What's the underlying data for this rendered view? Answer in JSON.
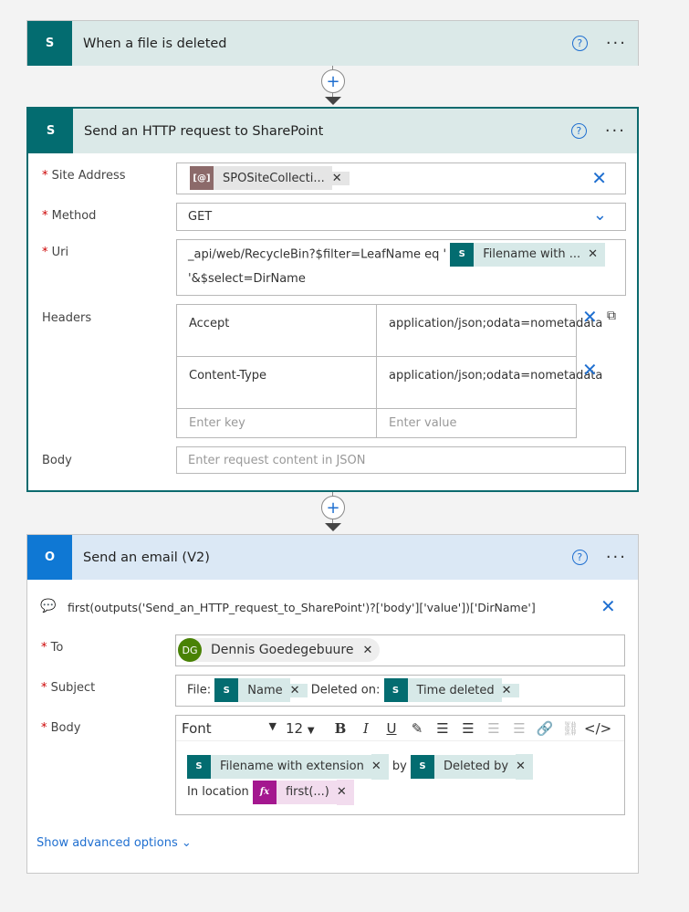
{
  "trigger": {
    "title": "When a file is deleted",
    "icon": "sharepoint-icon"
  },
  "http": {
    "title": "Send an HTTP request to SharePoint",
    "icon": "sharepoint-icon",
    "site_label": "Site Address",
    "site_token": "SPOSiteCollecti...",
    "site_token_icon": "[@]",
    "method_label": "Method",
    "method_value": "GET",
    "uri_label": "Uri",
    "uri_text1": "_api/web/RecycleBin?$filter=LeafName eq '",
    "uri_token": "Filename with ...",
    "uri_text2": "'&$select=DirName",
    "headers_label": "Headers",
    "headers": [
      {
        "key": "Accept",
        "value": "application/json;odata=nometadata"
      },
      {
        "key": "Content-Type",
        "value": "application/json;odata=nometadata"
      }
    ],
    "key_placeholder": "Enter key",
    "value_placeholder": "Enter value",
    "body_label": "Body",
    "body_placeholder": "Enter request content in JSON"
  },
  "email": {
    "title": "Send an email (V2)",
    "icon": "outlook-icon",
    "comment": "first(outputs('Send_an_HTTP_request_to_SharePoint')?['body']['value'])['DirName']",
    "to_label": "To",
    "to_initials": "DG",
    "to_name": "Dennis Goedegebuure",
    "avatar_color": "#498205",
    "subject_label": "Subject",
    "subject_text1": "File:",
    "subject_token1": "Name",
    "subject_text2": "Deleted on:",
    "subject_token2": "Time deleted",
    "body_label": "Body",
    "font": "Font",
    "font_size": "12",
    "body_token1": "Filename with extension",
    "body_text1": "by",
    "body_token2": "Deleted by",
    "body_text2": "In location",
    "body_expr": "first(...)",
    "expr_icon": "fx",
    "advanced": "Show advanced options"
  },
  "colors": {
    "sharepoint": "#036c70",
    "outlook": "#0f78d4",
    "accent": "#1f6fd0",
    "expression": "#a4178f"
  }
}
